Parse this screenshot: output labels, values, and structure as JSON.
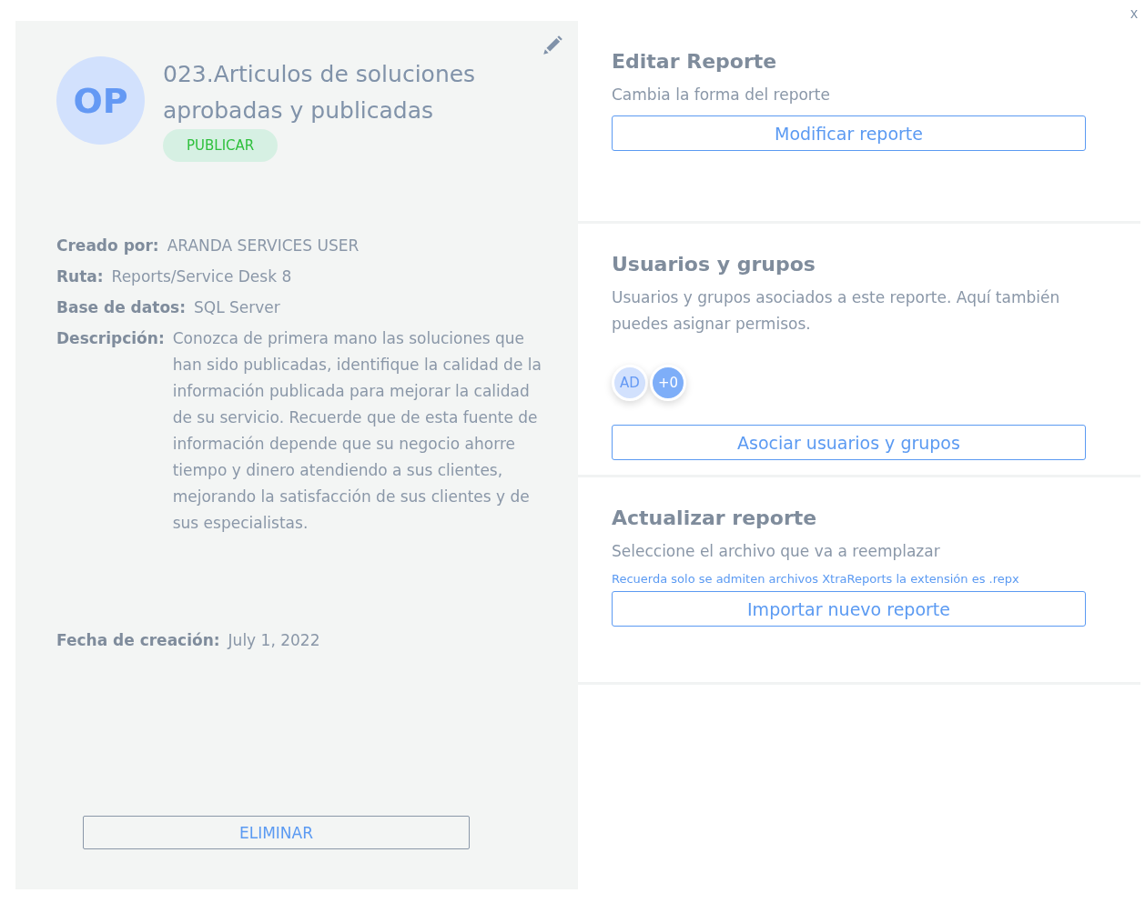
{
  "close_label": "x",
  "report": {
    "initials": "OP",
    "title": "023.Articulos de soluciones aprobadas y publicadas",
    "status": "PUBLICAR",
    "details": [
      {
        "label": "Creado por:",
        "value": "ARANDA SERVICES USER"
      },
      {
        "label": "Ruta:",
        "value": "Reports/Service Desk 8"
      },
      {
        "label": "Base de datos:",
        "value": "SQL Server"
      },
      {
        "label": "Descripción:",
        "value": "Conozca de primera mano las soluciones que han sido publicadas, identifique la calidad de la información publicada para mejorar la calidad de su servicio. Recuerde que de esta fuente de información depende que su negocio ahorre tiempo y dinero atendiendo a sus clientes, mejorando la satisfacción de sus clientes y de sus especialistas."
      }
    ],
    "created": {
      "label": "Fecha de creación:",
      "value": "July 1, 2022"
    },
    "delete_button": "ELIMINAR"
  },
  "sections": [
    {
      "kind": "edit",
      "title": "Editar Reporte",
      "subtitle": "Cambia la forma del reporte",
      "button": "Modificar reporte"
    },
    {
      "kind": "users",
      "title": "Usuarios y grupos",
      "subtitle": "Usuarios y grupos asociados a este reporte. Aquí también puedes asignar permisos.",
      "avatars": [
        "AD",
        "+0"
      ],
      "button": "Asociar usuarios y grupos"
    },
    {
      "kind": "update",
      "title": "Actualizar reporte",
      "subtitle": "Seleccione el archivo que va a reemplazar",
      "note": "Recuerda solo se admiten archivos XtraReports la extensión es .repx",
      "button": "Importar nuevo reporte"
    }
  ]
}
